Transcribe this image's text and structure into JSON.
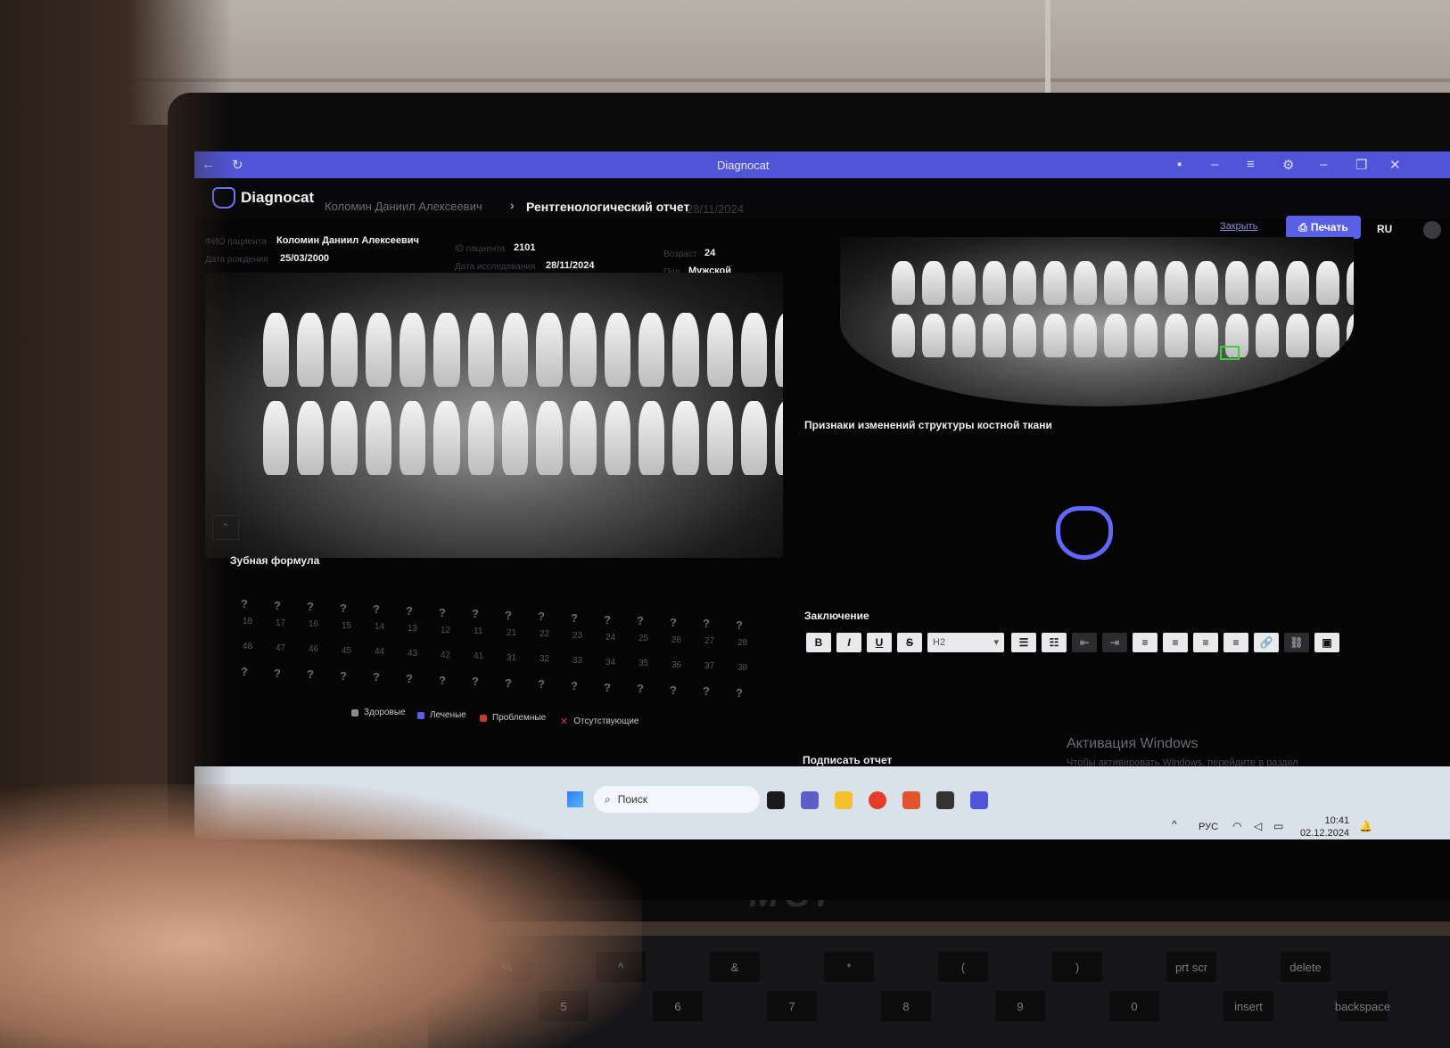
{
  "window": {
    "title": "Diagnocat"
  },
  "app": {
    "logo": "Diagnocat",
    "breadcrumb_patient": "Коломин Даниил Алексеевич",
    "breadcrumb_title": "Рентгенологический отчет",
    "breadcrumb_date": "28/11/2024",
    "close_label": "Закрыть",
    "print_label": "Печать",
    "language": "RU"
  },
  "patient": {
    "name_label": "ФИО пациента",
    "name": "Коломин Даниил Алексеевич",
    "birth_label": "Дата рождения",
    "birth": "25/03/2000",
    "id_label": "ID пациента",
    "id": "2101",
    "study_label": "Дата исследования",
    "study": "28/11/2024",
    "age_label": "Возраст",
    "age": "24",
    "sex_label": "Пол",
    "sex": "Мужской"
  },
  "dental_formula": {
    "title": "Зубная формула",
    "upper": [
      "18",
      "17",
      "16",
      "15",
      "14",
      "13",
      "12",
      "11",
      "21",
      "22",
      "23",
      "24",
      "25",
      "26",
      "27",
      "28"
    ],
    "lower": [
      "48",
      "47",
      "46",
      "45",
      "44",
      "43",
      "42",
      "41",
      "31",
      "32",
      "33",
      "34",
      "35",
      "36",
      "37",
      "38"
    ],
    "status_symbol": "?",
    "legend": [
      {
        "label": "Здоровые",
        "color": "#8a8a8f"
      },
      {
        "label": "Леченые",
        "color": "#5a60e6"
      },
      {
        "label": "Проблемные",
        "color": "#c23b36"
      },
      {
        "label": "Отсутствующие",
        "color": "#d23b36",
        "symbol": "✕"
      }
    ]
  },
  "finding": {
    "title": "Признаки изменений структуры костной ткани"
  },
  "conclusion": {
    "title": "Заключение",
    "toolbar": {
      "bold": "B",
      "italic": "I",
      "underline": "U",
      "strike": "S",
      "heading": "H2"
    }
  },
  "sign": {
    "title": "Подписать отчет"
  },
  "windows": {
    "activation_title": "Активация Windows",
    "activation_text": "Чтобы активировать Windows, перейдите в раздел \"Параметры\"."
  },
  "taskbar": {
    "search_placeholder": "Поиск",
    "language": "РУС",
    "time": "10:41",
    "date": "02.12.2024"
  },
  "device": {
    "brand": "MSI"
  },
  "keyboard": {
    "keys": [
      "%",
      "5",
      "^",
      "6",
      "&",
      "7",
      "*",
      "8",
      "(",
      "9",
      ")",
      "0",
      "prt scr",
      "insert",
      "delete",
      "backspace"
    ]
  },
  "colors": {
    "accent": "#5a60e6",
    "titlebar": "#4f55d6",
    "bg": "#050506"
  }
}
